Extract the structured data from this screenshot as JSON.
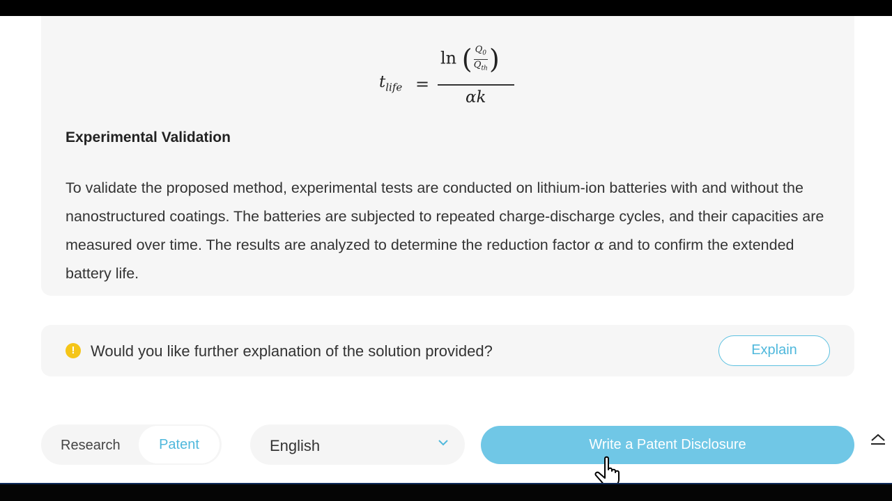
{
  "formula": {
    "lhs_var": "t",
    "lhs_sub": "life",
    "equals": "=",
    "ln": "ln",
    "q_num": "Q",
    "q_num_sub": "0",
    "q_den": "Q",
    "q_den_sub": "th",
    "denominator": "αk"
  },
  "section": {
    "heading": "Experimental Validation",
    "body_part1": "To validate the proposed method, experimental tests are conducted on lithium-ion batteries with and without the nanostructured coatings. The batteries are subjected to repeated charge-discharge cycles, and their capacities are measured over time. The results are analyzed to determine the reduction factor ",
    "body_symbol": "α",
    "body_part2": " and to confirm the extended battery life."
  },
  "prompt": {
    "icon": "info-icon",
    "text": "Would you like further explanation of the solution provided?",
    "explain_label": "Explain"
  },
  "toolbar": {
    "mode_research": "Research",
    "mode_patent": "Patent",
    "selected_mode": "Patent",
    "language": "English",
    "write_label": "Write a Patent Disclosure"
  },
  "colors": {
    "accent": "#70c7e6",
    "accent_text": "#4fb8dc",
    "info": "#f5c518",
    "card_bg": "#f6f6f6"
  }
}
